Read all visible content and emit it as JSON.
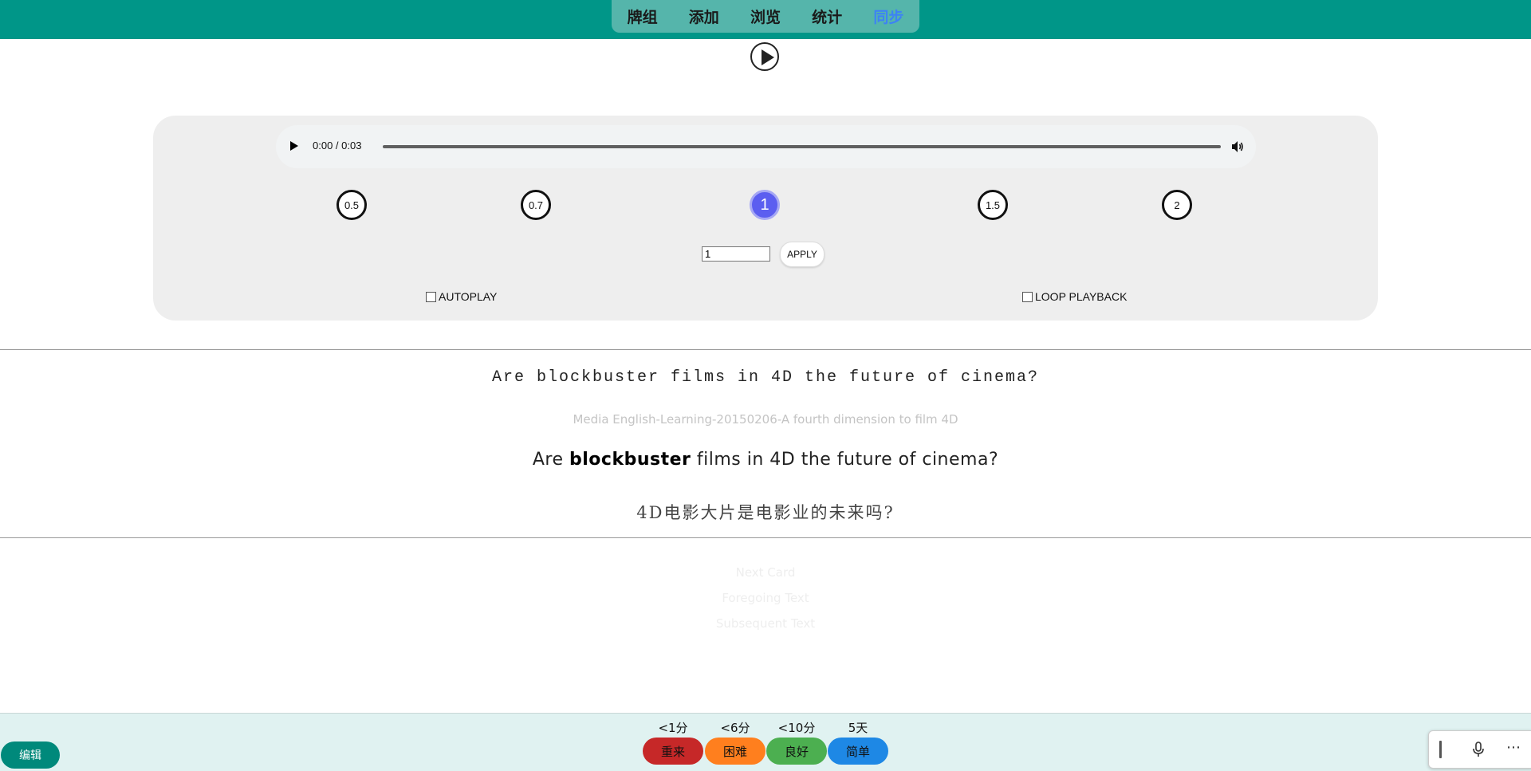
{
  "nav": {
    "items": [
      {
        "label": "牌组"
      },
      {
        "label": "添加"
      },
      {
        "label": "浏览"
      },
      {
        "label": "统计"
      },
      {
        "label": "同步"
      }
    ],
    "active_index": 4
  },
  "audio": {
    "time": "0:00 / 0:03",
    "progress": 0
  },
  "speeds": {
    "options": [
      "0.5",
      "0.7",
      "1",
      "1.5",
      "2"
    ],
    "selected": "1",
    "input_value": "1",
    "apply_label": "APPLY"
  },
  "options": {
    "autoplay_label": "AUTOPLAY",
    "loop_label": "LOOP PLAYBACK"
  },
  "card": {
    "front": "Are blockbuster films in 4D the future of cinema?",
    "source": "Media English-Learning-20150206-A fourth dimension to film 4D",
    "back_prefix": "Are ",
    "back_highlight": "blockbuster",
    "back_suffix": " films in 4D the future of cinema?",
    "translation": "4D电影大片是电影业的未来吗?"
  },
  "links": {
    "next_card": "Next Card",
    "foregoing": "Foregoing Text",
    "subsequent": "Subsequent Text"
  },
  "bottom": {
    "edit_label": "编辑",
    "answers": [
      {
        "interval": "<1分",
        "label": "重来",
        "color": "#c62828"
      },
      {
        "interval": "<6分",
        "label": "困难",
        "color": "#ff7f1e"
      },
      {
        "interval": "<10分",
        "label": "良好",
        "color": "#4caf50"
      },
      {
        "interval": "5天",
        "label": "简单",
        "color": "#1e88e5"
      }
    ]
  },
  "icons": [
    "play-icon",
    "volume-icon",
    "mic-icon",
    "more-icon"
  ]
}
